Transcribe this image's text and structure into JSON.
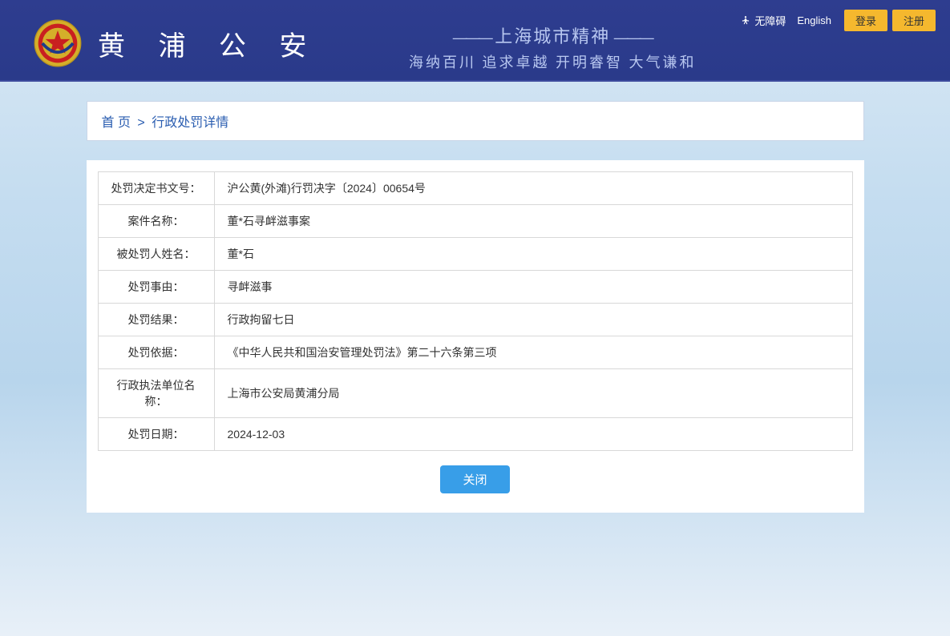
{
  "header": {
    "accessibility": "无障碍",
    "english": "English",
    "login": "登录",
    "register": "注册",
    "site_title": "黄 浦 公 安",
    "slogan1": "上海城市精神",
    "slogan2": "海纳百川 追求卓越 开明睿智 大气谦和"
  },
  "breadcrumb": {
    "home": "首 页",
    "sep": ">",
    "current": "行政处罚详情"
  },
  "detail": {
    "rows": [
      {
        "label": "处罚决定书文号：",
        "value": "沪公黄(外滩)行罚决字〔2024〕00654号"
      },
      {
        "label": "案件名称：",
        "value": "董*石寻衅滋事案"
      },
      {
        "label": "被处罚人姓名：",
        "value": "董*石"
      },
      {
        "label": "处罚事由：",
        "value": "寻衅滋事"
      },
      {
        "label": "处罚结果：",
        "value": "行政拘留七日"
      },
      {
        "label": "处罚依据：",
        "value": "《中华人民共和国治安管理处罚法》第二十六条第三项"
      },
      {
        "label": "行政执法单位名称：",
        "value": "上海市公安局黄浦分局"
      },
      {
        "label": "处罚日期：",
        "value": "2024-12-03"
      }
    ]
  },
  "close_label": "关闭"
}
